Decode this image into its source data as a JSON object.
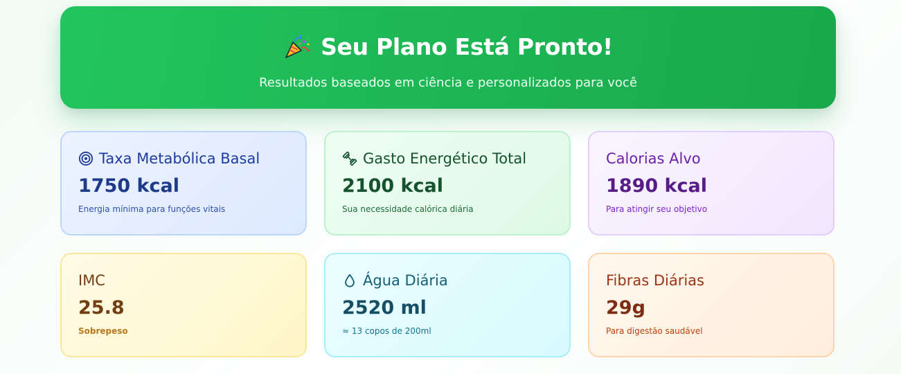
{
  "hero": {
    "title": "Seu Plano Está Pronto!",
    "subtitle": "Resultados baseados em ciência e personalizados para você",
    "icon": "party-popper-icon",
    "gradient": [
      "#22c55e",
      "#16a34a"
    ]
  },
  "cards": [
    {
      "title": "Taxa Metabólica Basal",
      "value": "1750 kcal",
      "note": "Energia mínima para funções vitais",
      "icon": "target-icon",
      "color": "#1e3a8a"
    },
    {
      "title": "Gasto Energético Total",
      "value": "2100 kcal",
      "note": "Sua necessidade calórica diária",
      "icon": "dumbbell-icon",
      "color": "#14532d"
    },
    {
      "title": "Calorias Alvo",
      "value": "1890 kcal",
      "note": "Para atingir seu objetivo",
      "color": "#581c87"
    },
    {
      "title": "IMC",
      "value": "25.8",
      "note": "Sobrepeso",
      "color": "#713f12"
    },
    {
      "title": "Água Diária",
      "value": "2520 ml",
      "note": "≈ 13 copos de 200ml",
      "icon": "droplet-icon",
      "color": "#164e63"
    },
    {
      "title": "Fibras Diárias",
      "value": "29g",
      "note": "Para digestão saudável",
      "color": "#7c2d12"
    }
  ]
}
